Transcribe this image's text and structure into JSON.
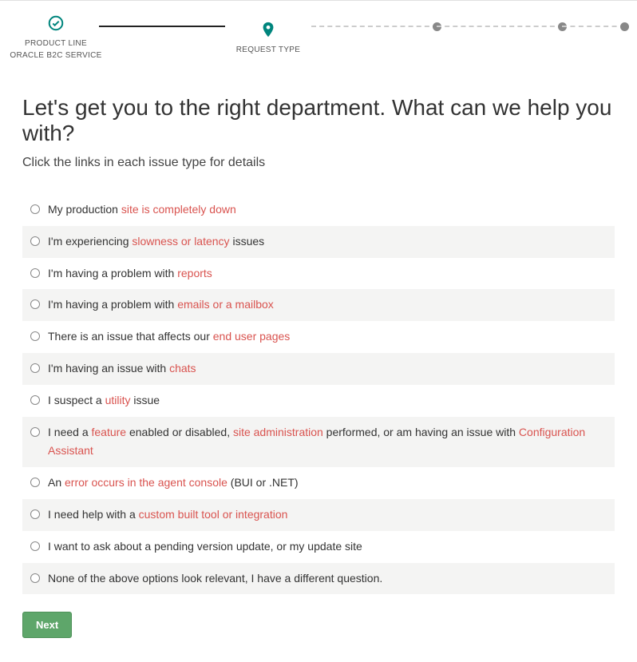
{
  "stepper": {
    "step1": {
      "label1": "PRODUCT LINE",
      "label2": "ORACLE B2C SERVICE"
    },
    "step2": {
      "label1": "REQUEST TYPE"
    }
  },
  "heading": "Let's get you to the right department. What can we help you with?",
  "subheading": "Click the links in each issue type for details",
  "options": [
    {
      "segments": [
        {
          "t": "My production "
        },
        {
          "t": "site is completely down",
          "link": true
        }
      ]
    },
    {
      "segments": [
        {
          "t": "I'm experiencing "
        },
        {
          "t": "slowness or latency",
          "link": true
        },
        {
          "t": " issues"
        }
      ]
    },
    {
      "segments": [
        {
          "t": "I'm having a problem with "
        },
        {
          "t": "reports",
          "link": true
        }
      ]
    },
    {
      "segments": [
        {
          "t": "I'm having a problem with "
        },
        {
          "t": "emails or a mailbox",
          "link": true
        }
      ]
    },
    {
      "segments": [
        {
          "t": "There is an issue that affects our "
        },
        {
          "t": "end user pages",
          "link": true
        }
      ]
    },
    {
      "segments": [
        {
          "t": "I'm having an issue with "
        },
        {
          "t": "chats",
          "link": true
        }
      ]
    },
    {
      "segments": [
        {
          "t": "I suspect a "
        },
        {
          "t": "utility",
          "link": true
        },
        {
          "t": " issue"
        }
      ]
    },
    {
      "segments": [
        {
          "t": "I need a "
        },
        {
          "t": "feature",
          "link": true
        },
        {
          "t": " enabled or disabled, "
        },
        {
          "t": "site administration",
          "link": true
        },
        {
          "t": " performed, or am having an issue with "
        },
        {
          "t": "Configuration Assistant",
          "link": true
        }
      ]
    },
    {
      "segments": [
        {
          "t": "An "
        },
        {
          "t": "error occurs in the agent console",
          "link": true
        },
        {
          "t": " (BUI or .NET)"
        }
      ]
    },
    {
      "segments": [
        {
          "t": "I need help with a "
        },
        {
          "t": "custom built tool or integration",
          "link": true
        }
      ]
    },
    {
      "segments": [
        {
          "t": "I want to ask about a pending version update, or my update site"
        }
      ]
    },
    {
      "segments": [
        {
          "t": "None of the above options look relevant, I have a different question."
        }
      ]
    }
  ],
  "next_label": "Next",
  "colors": {
    "accent": "#d9534f",
    "teal": "#00857d",
    "button": "#5ea66a"
  }
}
